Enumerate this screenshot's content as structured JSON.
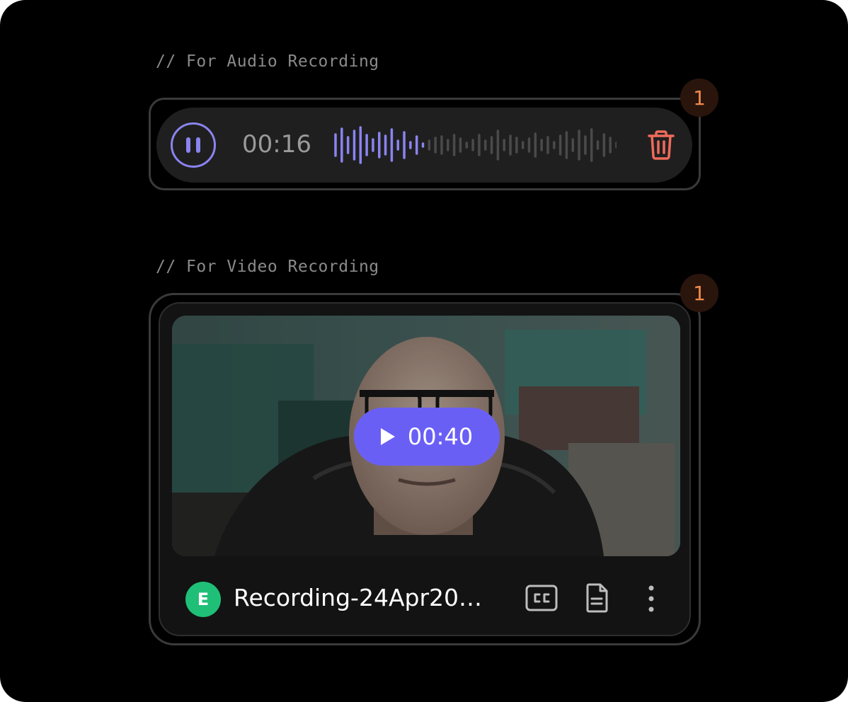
{
  "audio_section": {
    "label": "// For Audio Recording",
    "badge": "1",
    "timer": "00:16",
    "waveform_played_fraction": 0.33,
    "icons": {
      "pause": "pause-icon",
      "delete": "trash-icon"
    }
  },
  "video_section": {
    "label": "// For Video Recording",
    "badge": "1",
    "duration": "00:40",
    "avatar_initial": "E",
    "file_name": "Recording-24Apr20…",
    "icons": {
      "play": "play-icon",
      "captions": "cc-icon",
      "transcript": "document-icon",
      "more": "more-vertical-icon"
    }
  },
  "colors": {
    "accent": "#6a5ff5",
    "wave_active": "#8a84f0",
    "wave_idle": "#4a4a4a",
    "delete": "#f06b5a",
    "badge_text": "#f08a4b",
    "avatar": "#1fbf77"
  }
}
